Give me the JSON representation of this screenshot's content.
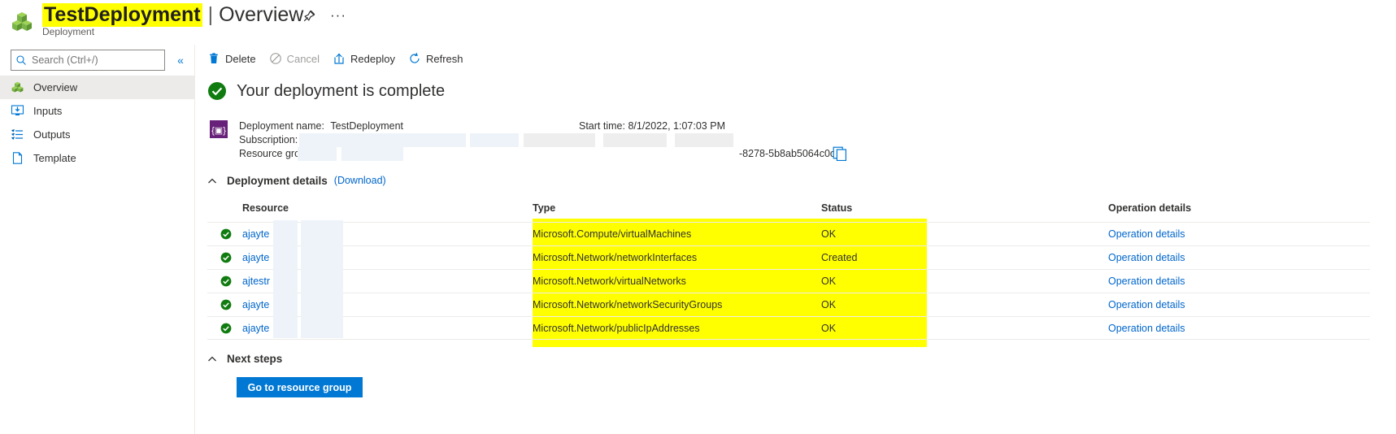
{
  "header": {
    "title_main": "TestDeployment",
    "title_separator": "|",
    "title_sub": "Overview",
    "subtitle": "Deployment",
    "ellipsis": "···",
    "highlight_color": "#ffff00"
  },
  "sidebar": {
    "search_placeholder": "Search (Ctrl+/)",
    "search_value": "",
    "collapse_label": "«",
    "items": [
      {
        "label": "Overview",
        "icon": "cubes-icon",
        "selected": true
      },
      {
        "label": "Inputs",
        "icon": "inputs-icon",
        "selected": false
      },
      {
        "label": "Outputs",
        "icon": "outputs-icon",
        "selected": false
      },
      {
        "label": "Template",
        "icon": "template-icon",
        "selected": false
      }
    ]
  },
  "toolbar": {
    "delete_label": "Delete",
    "cancel_label": "Cancel",
    "redeploy_label": "Redeploy",
    "refresh_label": "Refresh"
  },
  "main": {
    "status_heading": "Your deployment is complete",
    "deployment_name_key": "Deployment name:",
    "deployment_name_value": "TestDeployment",
    "subscription_key": "Subscription:",
    "subscription_value": "",
    "resource_group_key": "Resource grou",
    "resource_group_value": "",
    "start_time_key": "Start time:",
    "start_time_value": "8/1/2022, 1:07:03 PM",
    "correlation_id_fragment": "-8278-5b8ab5064c0c",
    "deployment_details_title": "Deployment details",
    "download_link": "(Download)",
    "next_steps_title": "Next steps",
    "go_to_resource_group_label": "Go to resource group"
  },
  "table": {
    "columns": [
      "Resource",
      "Type",
      "Status",
      "Operation details"
    ],
    "rows": [
      {
        "resource": "ajayte",
        "type": "Microsoft.Compute/virtualMachines",
        "status": "OK",
        "operation": "Operation details"
      },
      {
        "resource": "ajayte",
        "type": "Microsoft.Network/networkInterfaces",
        "status": "Created",
        "operation": "Operation details"
      },
      {
        "resource": "ajtestr",
        "type": "Microsoft.Network/virtualNetworks",
        "status": "OK",
        "operation": "Operation details"
      },
      {
        "resource": "ajayte",
        "type": "Microsoft.Network/networkSecurityGroups",
        "status": "OK",
        "operation": "Operation details"
      },
      {
        "resource": "ajayte",
        "type": "Microsoft.Network/publicIpAddresses",
        "status": "OK",
        "operation": "Operation details"
      }
    ]
  },
  "colors": {
    "accent": "#0078d4",
    "link": "#0066cc",
    "success": "#107c10",
    "deployment_icon": "#68217a",
    "highlight": "#ffff00"
  }
}
